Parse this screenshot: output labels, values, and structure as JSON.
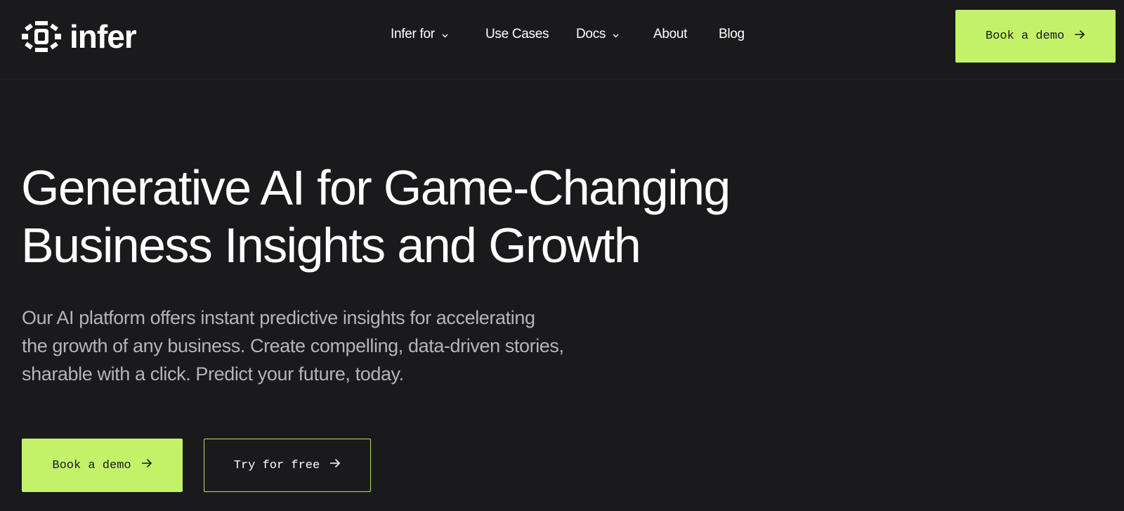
{
  "brand": {
    "name": "infer",
    "logo_icon": "infer-eye-logo-icon"
  },
  "nav": {
    "items": [
      {
        "label": "Infer for",
        "has_dropdown": true,
        "icon": "chevron-down-icon"
      },
      {
        "label": "Use Cases",
        "has_dropdown": false
      },
      {
        "label": "Docs",
        "has_dropdown": true,
        "icon": "chevron-down-icon"
      },
      {
        "label": "About",
        "has_dropdown": false
      },
      {
        "label": "Blog",
        "has_dropdown": false
      }
    ]
  },
  "header_cta": {
    "label": "Book a demo",
    "icon": "arrow-right-icon"
  },
  "hero": {
    "title_lines": [
      "Generative AI for Game-Changing",
      "Business Insights and Growth"
    ],
    "subtitle_lines": [
      "Our AI platform offers instant predictive insights for accelerating",
      "the growth of any business. Create compelling, data-driven stories,",
      "sharable with a click. Predict your future, today."
    ],
    "primary_cta": {
      "label": "Book a demo",
      "icon": "arrow-right-icon"
    },
    "secondary_cta": {
      "label": "Try for free",
      "icon": "arrow-right-icon"
    }
  },
  "colors": {
    "background": "#1a1a1c",
    "accent": "#c3f268",
    "text": "#ffffff",
    "muted_text": "#b4b4bc"
  }
}
